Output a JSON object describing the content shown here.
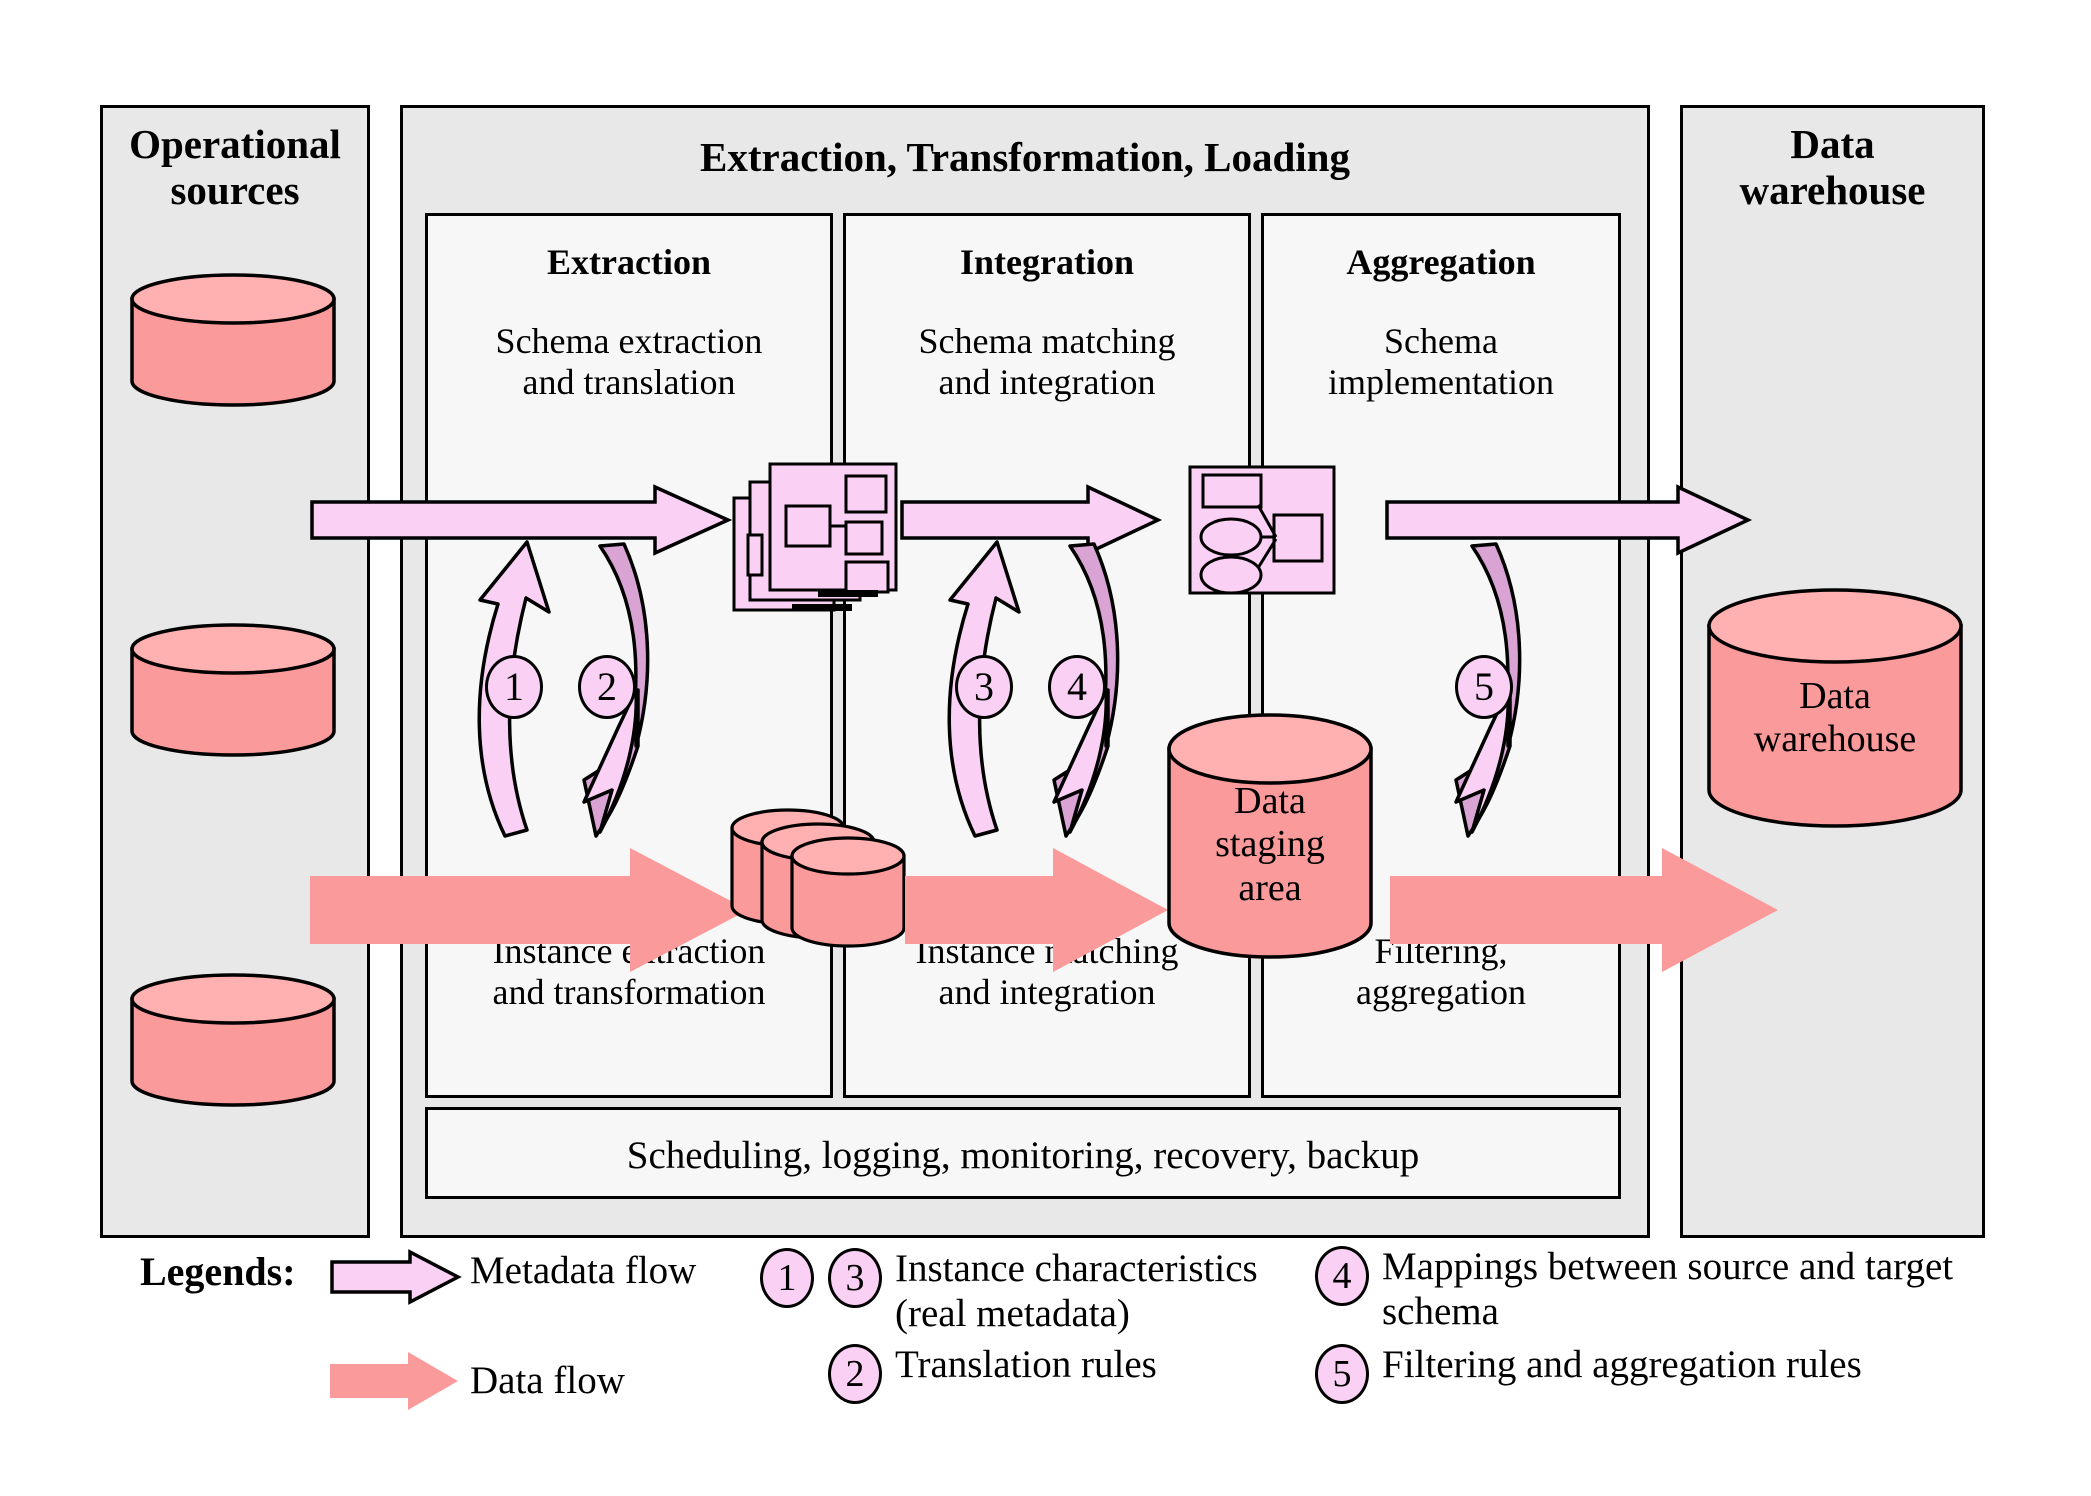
{
  "diagram": {
    "title_operational_sources": "Operational\nsources",
    "title_etl": "Extraction, Transformation, Loading",
    "title_data_warehouse": "Data\nwarehouse",
    "bottom_bar": "Scheduling, logging, monitoring, recovery, backup"
  },
  "columns": [
    {
      "id": "extraction",
      "title": "Extraction",
      "top_text": "Schema extraction\nand translation",
      "bottom_text": "Instance extraction\nand transformation",
      "badges": [
        "1",
        "2"
      ]
    },
    {
      "id": "integration",
      "title": "Integration",
      "top_text": "Schema matching\nand integration",
      "bottom_text": "Instance matching\nand integration",
      "badges": [
        "3",
        "4"
      ]
    },
    {
      "id": "aggregation",
      "title": "Aggregation",
      "top_text": "Schema\nimplementation",
      "bottom_text": "Filtering,\naggregation",
      "badges": [
        "5"
      ]
    }
  ],
  "cylinders": {
    "source_1": "",
    "source_2": "",
    "source_3": "",
    "staging": "Data\nstaging\narea",
    "warehouse": "Data\nwarehouse"
  },
  "legends": {
    "title": "Legends:",
    "flows": [
      {
        "icon": "metadata-flow-arrow",
        "label": "Metadata flow"
      },
      {
        "icon": "data-flow-arrow",
        "label": "Data flow"
      }
    ],
    "numbered": [
      {
        "badges": [
          "1",
          "3"
        ],
        "label": "Instance characteristics\n(real metadata)"
      },
      {
        "badges": [
          "2"
        ],
        "label": "Translation rules"
      },
      {
        "badges": [
          "4"
        ],
        "label": "Mappings between source and target\nschema"
      },
      {
        "badges": [
          "5"
        ],
        "label": "Filtering and aggregation rules"
      }
    ]
  },
  "colors": {
    "panel_fill": "#e8e8e8",
    "subpanel_fill": "#f7f7f7",
    "metadata_arrow": "#fbd0f5",
    "metadata_arrow_dark": "#d9a3d3",
    "data_arrow": "#fb9a9a",
    "cylinder_body": "#fb9a9a",
    "cylinder_top": "#ffb3b3",
    "icon_fill": "#fbd0f5",
    "stroke": "#000000"
  }
}
